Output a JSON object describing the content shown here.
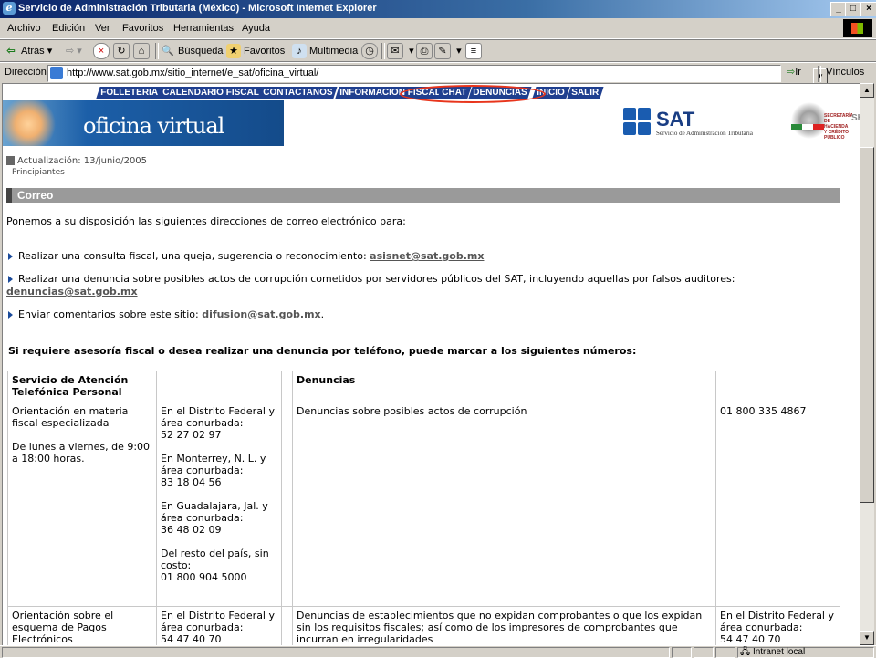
{
  "window": {
    "title": "Servicio de Administración Tributaria (México) - Microsoft Internet Explorer"
  },
  "menu": [
    "Archivo",
    "Edición",
    "Ver",
    "Favoritos",
    "Herramientas",
    "Ayuda"
  ],
  "toolbar": {
    "back": "Atrás",
    "search": "Búsqueda",
    "favorites": "Favoritos",
    "media": "Multimedia"
  },
  "address": {
    "label": "Dirección",
    "url": "http://www.sat.gob.mx/sitio_internet/e_sat/oficina_virtual/",
    "go": "Ir",
    "links": "Vínculos"
  },
  "nav": [
    "FOLLETERIA",
    "CALENDARIO FISCAL",
    "CONTACTANOS",
    "INFORMACION FISCAL",
    "CHAT",
    "DENUNCIAS",
    "INICIO",
    "SALIR"
  ],
  "banner": {
    "title": "oficina virtual"
  },
  "sat": {
    "name": "SAT",
    "subtitle": "Servicio de Administración Tributaria",
    "secretaria": "SECRETARÍA DE HACIENDA Y CRÉDITO PÚBLICO",
    "shcp": "SHCP"
  },
  "page": {
    "updated": "Actualización: 13/junio/2005",
    "breadcrumb": "Principiantes",
    "section": "Correo",
    "intro": "Ponemos a su disposición las siguientes direcciones de correo electrónico para:",
    "item1_text": "Realizar una consulta fiscal, una queja, sugerencia o reconocimiento: ",
    "item1_mail": "asisnet@sat.gob.mx",
    "item2_text": "Realizar una denuncia sobre posibles actos de corrupción cometidos por servidores públicos del SAT, incluyendo aquellas por falsos auditores:",
    "item2_mail": "denuncias@sat.gob.mx",
    "item3_text": "Enviar comentarios sobre este sitio: ",
    "item3_mail": "difusion@sat.gob.mx",
    "item3_end": ".",
    "phone_heading": "Si requiere asesoría fiscal o desea realizar una denuncia por teléfono, puede marcar a los siguientes números:"
  },
  "table": {
    "h1": "Servicio de Atención Telefónica Personal",
    "h2": "",
    "h3": "",
    "h4": "Denuncias",
    "h5": "",
    "r1c1a": "Orientación en materia fiscal especializada",
    "r1c1b": "De lunes a viernes, de 9:00 a 18:00 horas.",
    "r1c2a": "En el Distrito Federal y área conurbada:",
    "r1c2b": "52 27  02 97",
    "r1c2c": "En Monterrey, N. L. y área conurbada:",
    "r1c2d": "83 18  04 56",
    "r1c2e": "En Guadalajara, Jal. y área conurbada:",
    "r1c2f": "36 48  02 09",
    "r1c2g": "Del resto del país, sin costo:",
    "r1c2h": "01 800 904  5000",
    "r1c4": "Denuncias sobre posibles actos de corrupción",
    "r1c5": "01 800 335 4867",
    "r2c1": "Orientación sobre el esquema de Pagos Electrónicos",
    "r2c2a": "En el Distrito Federal y área conurbada:",
    "r2c2b": "54 47  40 70",
    "r2c4": "Denuncias de establecimientos que no expidan comprobantes o que los expidan sin los requisitos fiscales; así como de los impresores de comprobantes que incurran en irregularidades",
    "r2c5a": "En el Distrito Federal y área conurbada:",
    "r2c5b": "54 47  40 70"
  },
  "status": {
    "zone": "Intranet local"
  },
  "colors": {
    "nav": "#1f3f8f",
    "highlight_circle": "#e8351c",
    "section_bar": "#9a9a9a"
  }
}
